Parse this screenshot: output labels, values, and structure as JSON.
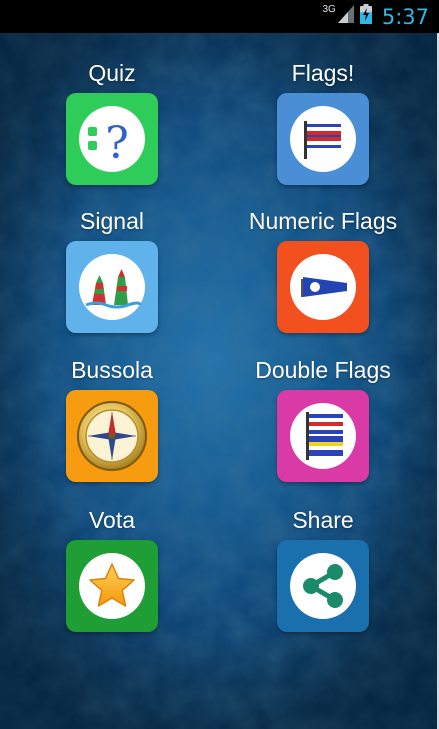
{
  "status_bar": {
    "network": "3G",
    "time": "5:37",
    "clock_color": "#33b5e5"
  },
  "menu": [
    {
      "label": "Quiz",
      "icon": "quiz-icon",
      "color": "#2ecc59"
    },
    {
      "label": "Flags!",
      "icon": "flag-icon",
      "color": "#4a8fd6"
    },
    {
      "label": "Signal",
      "icon": "signal-buoys-icon",
      "color": "#5fb3ea"
    },
    {
      "label": "Numeric Flags",
      "icon": "pennant-icon",
      "color": "#f2501e"
    },
    {
      "label": "Bussola",
      "icon": "compass-icon",
      "color": "#f79b10"
    },
    {
      "label": "Double Flags",
      "icon": "double-flag-icon",
      "color": "#d93aa6"
    },
    {
      "label": "Vota",
      "icon": "star-icon",
      "color": "#1f9e35"
    },
    {
      "label": "Share",
      "icon": "share-icon",
      "color": "#1a6fad"
    }
  ]
}
